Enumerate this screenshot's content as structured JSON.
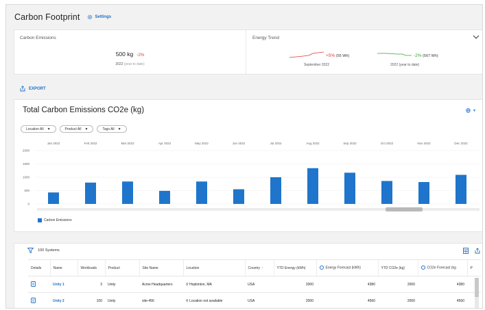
{
  "header": {
    "title": "Carbon Footprint",
    "settings_label": "Settings"
  },
  "summary": {
    "emissions_label": "Carbon Emissions",
    "emissions_value": "500 kg",
    "emissions_change": "2%",
    "emissions_year": "2022",
    "emissions_year_note": "(year to date)",
    "trend_label": "Energy Trend",
    "trend1_change": "+5%",
    "trend1_value": "(55 Wh)",
    "trend1_period": "September 2022",
    "trend2_change": "-2%",
    "trend2_value": "(567 Wh)",
    "trend2_period": "2022 (year to date)"
  },
  "export_label": "EXPORT",
  "chart_panel": {
    "filters": [
      "Location All",
      "Product All",
      "Tags All"
    ]
  },
  "chart_data": {
    "type": "bar",
    "title": "Total Carbon Emissions CO2e (kg)",
    "categories": [
      "Jan 2022",
      "Feb 2022",
      "Mar 2022",
      "Apr 2022",
      "May 2022",
      "Jun 2022",
      "Jul 2022",
      "Aug 2022",
      "Sep 2022",
      "Oct 2022",
      "Nov 2022",
      "Dec 2022"
    ],
    "series": [
      {
        "name": "Carbon Emissions",
        "color": "#1f75cb",
        "values": [
          430,
          800,
          840,
          490,
          840,
          550,
          1000,
          1340,
          1170,
          860,
          820,
          1090
        ]
      }
    ],
    "yticks": [
      0,
      500,
      1000,
      1500,
      2000
    ],
    "ytick_labels": [
      "0",
      "500",
      "1000",
      "1500",
      "2000"
    ],
    "ylim": [
      0,
      2000
    ],
    "grid": true,
    "legend_position": "bottom-left"
  },
  "table": {
    "count_label": "100 Systems",
    "columns": [
      "Details",
      "Name",
      "Workloads",
      "Product",
      "Site Name",
      "Location",
      "Country",
      "YTD Energy (kWh)",
      "Energy Forecast (kWh)",
      "YTD CO2e (kg)",
      "CO2e Forecast (kg",
      "P"
    ],
    "rows": [
      {
        "name": "Unity 1",
        "workloads": "3",
        "product": "Unity",
        "site": "Acme Headquarters",
        "location": "Hopkinton, MA",
        "country": "USA",
        "ytd_energy": "2000",
        "energy_forecast": "4380",
        "ytd_co2e": "2000",
        "co2e_forecast": "4380"
      },
      {
        "name": "Unity 2",
        "workloads": "100",
        "product": "Unity",
        "site": "site-456",
        "location": "Location not available",
        "country": "USA",
        "ytd_energy": "2000",
        "energy_forecast": "4560",
        "ytd_co2e": "2000",
        "co2e_forecast": "4560"
      }
    ]
  },
  "colors": {
    "accent": "#1f6fc5",
    "bar": "#1f75cb",
    "negative": "#e03434",
    "positive": "#2fa82f"
  }
}
